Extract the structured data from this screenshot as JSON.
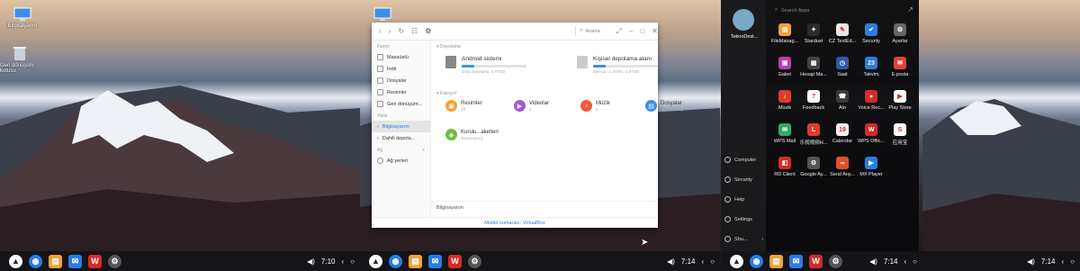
{
  "panel1": {
    "desktop_icons": [
      {
        "label": "Bilgisayarım",
        "icon": "computer-icon"
      },
      {
        "label": "Geri dönüşüm kutusu",
        "icon": "trash-icon"
      }
    ],
    "time": "7:10"
  },
  "panel2": {
    "time": "7:14",
    "file_manager": {
      "search_placeholder": "Arama",
      "sidebar": {
        "favorites_header": "Favori",
        "favorites": [
          "Masaüstü",
          "İndir",
          "Dosyalar",
          "Resimler",
          "Geri dönüşüm..."
        ],
        "devices_header": "Helal",
        "devices": [
          "Bilgisayarım",
          "Dahili depola..."
        ],
        "network_header": "Ağ",
        "network": [
          "Ağ yerleri"
        ]
      },
      "storage_header": "Depolama",
      "storage": [
        {
          "name": "Android sistemi",
          "detail": "Giriş depolama: 3,87GB",
          "fill": 0.2
        },
        {
          "name": "Kişisel depolama alanı",
          "detail": "Mevcut: 3,16GB / 3,87GB",
          "fill": 0.2
        }
      ],
      "category_header": "Kategori",
      "categories": [
        {
          "name": "Resimler",
          "detail": "10",
          "color": "#f2a13a",
          "glyph": "▣"
        },
        {
          "name": "Videolar",
          "detail": "0",
          "color": "#a35ad8",
          "glyph": "▶"
        },
        {
          "name": "Müzik",
          "detail": "0",
          "color": "#f05a3a",
          "glyph": "♪"
        },
        {
          "name": "Dosyalar",
          "detail": "Taranmamış",
          "color": "#3b8fe8",
          "glyph": "▤"
        },
        {
          "name": "Kurulu...aketleri",
          "detail": "Taranmamış",
          "color": "#6cbf3c",
          "glyph": "◆"
        }
      ],
      "location": "Bilgisayarım",
      "status": "Model numarası: VirtualBox"
    }
  },
  "panel3": {
    "time": "7:14",
    "user": "TeknoDest...",
    "search_placeholder": "Search Apps",
    "side_items": [
      "Computer",
      "Security",
      "Help",
      "Settings",
      "Shu..."
    ],
    "apps": [
      {
        "label": "FileManag...",
        "color": "#f2a13a",
        "glyph": "▤"
      },
      {
        "label": "Stardust",
        "color": "#2b2b2b",
        "glyph": "✦"
      },
      {
        "label": "CZ TextEd...",
        "color": "#e8e8e8",
        "glyph": "✎"
      },
      {
        "label": "Security",
        "color": "#2a7de1",
        "glyph": "✔"
      },
      {
        "label": "Ayarlar",
        "color": "#666666",
        "glyph": "⚙"
      },
      {
        "label": "Galeri",
        "color": "#c23bb0",
        "glyph": "▣"
      },
      {
        "label": "Hesap Ma...",
        "color": "#444444",
        "glyph": "▦"
      },
      {
        "label": "Saat",
        "color": "#3456a8",
        "glyph": "◷"
      },
      {
        "label": "Takvim",
        "color": "#2a7de1",
        "glyph": "23"
      },
      {
        "label": "E-posta",
        "color": "#e04040",
        "glyph": "✉"
      },
      {
        "label": "Müzik",
        "color": "#e03a2a",
        "glyph": "♪"
      },
      {
        "label": "Feedback",
        "color": "#ffffff",
        "glyph": "?"
      },
      {
        "label": "Alo",
        "color": "#3a3a3a",
        "glyph": "☎"
      },
      {
        "label": "Voice Rec...",
        "color": "#d42a2a",
        "glyph": "●"
      },
      {
        "label": "Play Store",
        "color": "#ffffff",
        "glyph": "▶"
      },
      {
        "label": "WPS Mail",
        "color": "#2ea86b",
        "glyph": "✉"
      },
      {
        "label": "乐视视频H...",
        "color": "#e03a2a",
        "glyph": "L"
      },
      {
        "label": "Calendar",
        "color": "#f0f0f0",
        "glyph": "19"
      },
      {
        "label": "WPS Offic...",
        "color": "#d42a2a",
        "glyph": "W"
      },
      {
        "label": "应用宝",
        "color": "#ffffff",
        "glyph": "S"
      },
      {
        "label": "RD Client",
        "color": "#d42a2a",
        "glyph": "◧"
      },
      {
        "label": "Google Ay...",
        "color": "#555555",
        "glyph": "⚙"
      },
      {
        "label": "Send Any...",
        "color": "#e05030",
        "glyph": "∞"
      },
      {
        "label": "MX Player",
        "color": "#2a7de1",
        "glyph": "▶"
      }
    ]
  },
  "panel4": {
    "time": "7:14"
  },
  "taskbar_icons": [
    "browser-icon",
    "files-icon",
    "mail-icon",
    "wps-icon",
    "settings-icon"
  ]
}
